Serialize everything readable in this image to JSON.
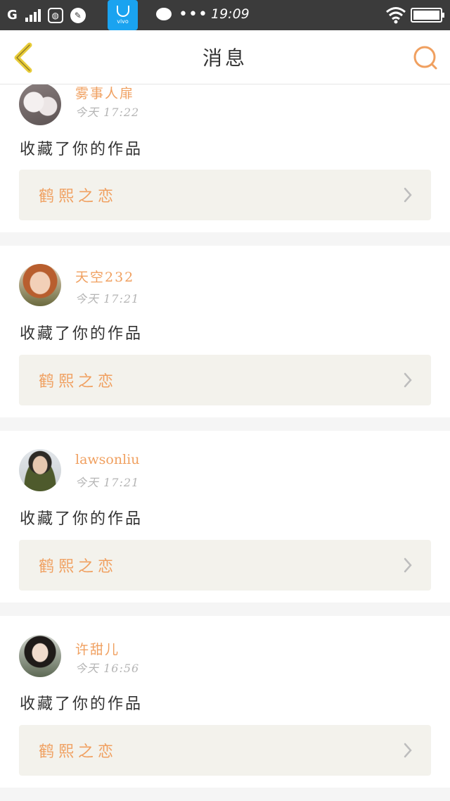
{
  "status_bar": {
    "carrier": "G",
    "app_icon_text": "vivo",
    "dots": "•••",
    "time": "19:09"
  },
  "nav": {
    "title": "消息",
    "back_icon": "chevron-left-icon",
    "search_icon": "search-icon"
  },
  "colors": {
    "accent": "#f0a060",
    "back": "#e8cc3a",
    "status_bar": "#3b3b3b",
    "work_box": "#f3f2ec"
  },
  "messages": [
    {
      "username": "雾事人扉",
      "time": "今天 17:22",
      "action": "收藏了你的作品",
      "work": "鹤熙之恋"
    },
    {
      "username": "天空232",
      "time": "今天 17:21",
      "action": "收藏了你的作品",
      "work": "鹤熙之恋"
    },
    {
      "username": "lawsonliu",
      "time": "今天 17:21",
      "action": "收藏了你的作品",
      "work": "鹤熙之恋"
    },
    {
      "username": "许甜儿",
      "time": "今天 16:56",
      "action": "收藏了你的作品",
      "work": "鹤熙之恋"
    }
  ]
}
